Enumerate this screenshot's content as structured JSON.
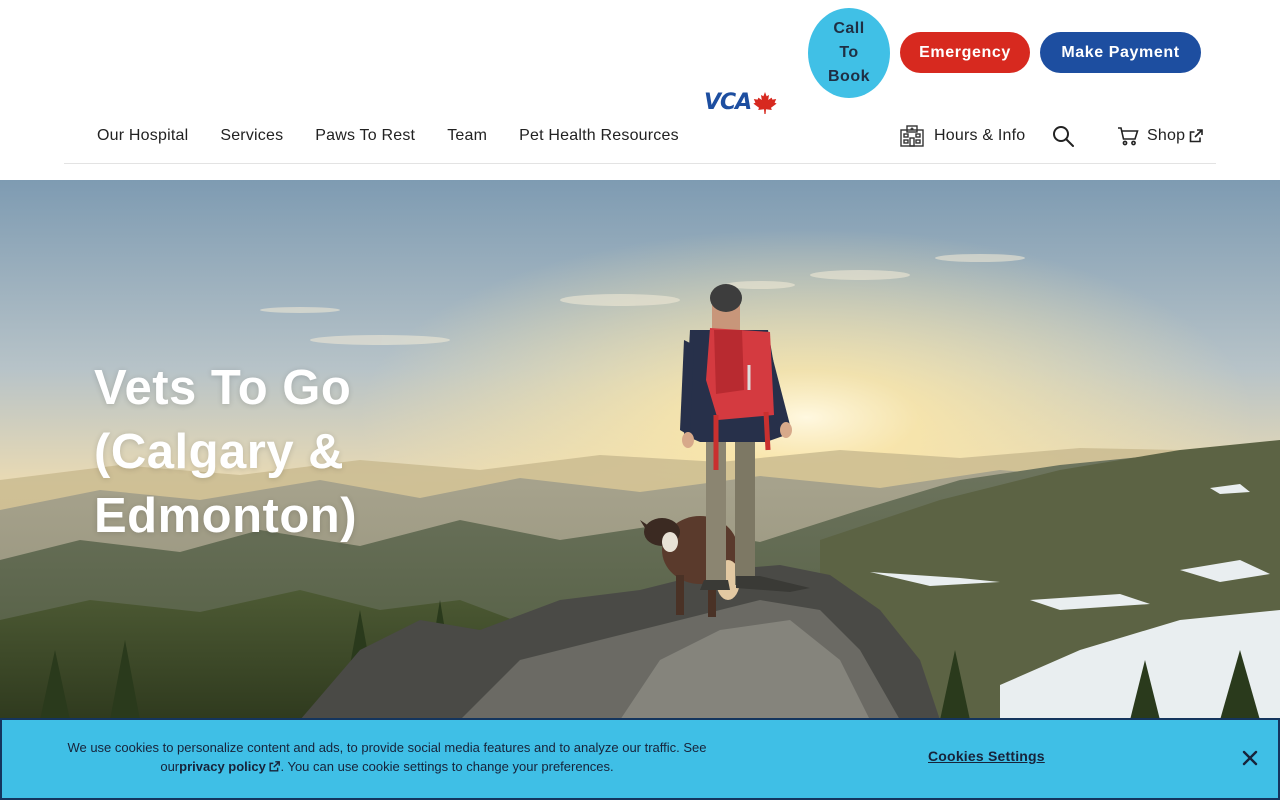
{
  "header": {
    "call_button": "Call To Book",
    "emergency_button": "Emergency",
    "payment_button": "Make Payment",
    "logo_text": "VCA",
    "logo_leaf_color": "#d7291f"
  },
  "nav": {
    "items": [
      "Our Hospital",
      "Services",
      "Paws To Rest",
      "Team",
      "Pet Health Resources"
    ]
  },
  "utility": {
    "hours_label": "Hours & Info",
    "search_icon": "search-icon",
    "shop_label": "Shop"
  },
  "hero": {
    "title": "Vets To Go (Calgary & Edmonton)"
  },
  "cookie_banner": {
    "text_before": "We use cookies to personalize content and ads, to provide social media features and to analyze our traffic. See our",
    "link_label": "privacy policy",
    "text_after": ". You can use cookie settings to change your preferences.",
    "settings_label": "Cookies Settings",
    "close_icon": "close-icon"
  },
  "colors": {
    "call_bg": "#40c0e6",
    "emergency_bg": "#d7291f",
    "payment_bg": "#1d4ea0",
    "cookie_bg": "#3fbfe6"
  }
}
